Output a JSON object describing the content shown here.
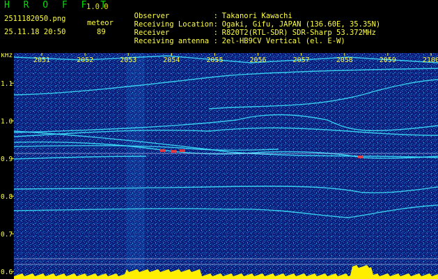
{
  "header": {
    "app_name": "H R O F F T",
    "version": "1.0.0",
    "filename": "2511182050.png",
    "datetime": "25.11.18 20:50",
    "mode": "meteor",
    "count": "89",
    "info": [
      {
        "label": "Observer",
        "value": "Takanori Kawachi"
      },
      {
        "label": "Receiving Location",
        "value": "Ogaki, Gifu, JAPAN (136.60E, 35.35N)"
      },
      {
        "label": "Receiver",
        "value": "R820T2(RTL-SDR) SDR-Sharp 53.372MHz"
      },
      {
        "label": "Receiving antenna",
        "value": "2el-HB9CV Vertical (el. E-W)"
      }
    ]
  },
  "colors": {
    "background": "#000000",
    "plot_bg": "#0a1e7a",
    "title_green": "#00e000",
    "text_yellow": "#ffff40",
    "signal_cyan": "#40e8ff",
    "hot_red": "#ff3030",
    "amp_yellow": "#ffee00"
  },
  "chart_data": {
    "type": "heatmap",
    "yunit": "kHz",
    "x_ticks": [
      "2051",
      "2052",
      "2053",
      "2054",
      "2055",
      "2056",
      "2057",
      "2058",
      "2059",
      "2100"
    ],
    "y_ticks": [
      "1.1",
      "1.0",
      "0.9",
      "0.8",
      "0.7",
      "0.6"
    ],
    "ylim": [
      0.58,
      1.18
    ]
  }
}
